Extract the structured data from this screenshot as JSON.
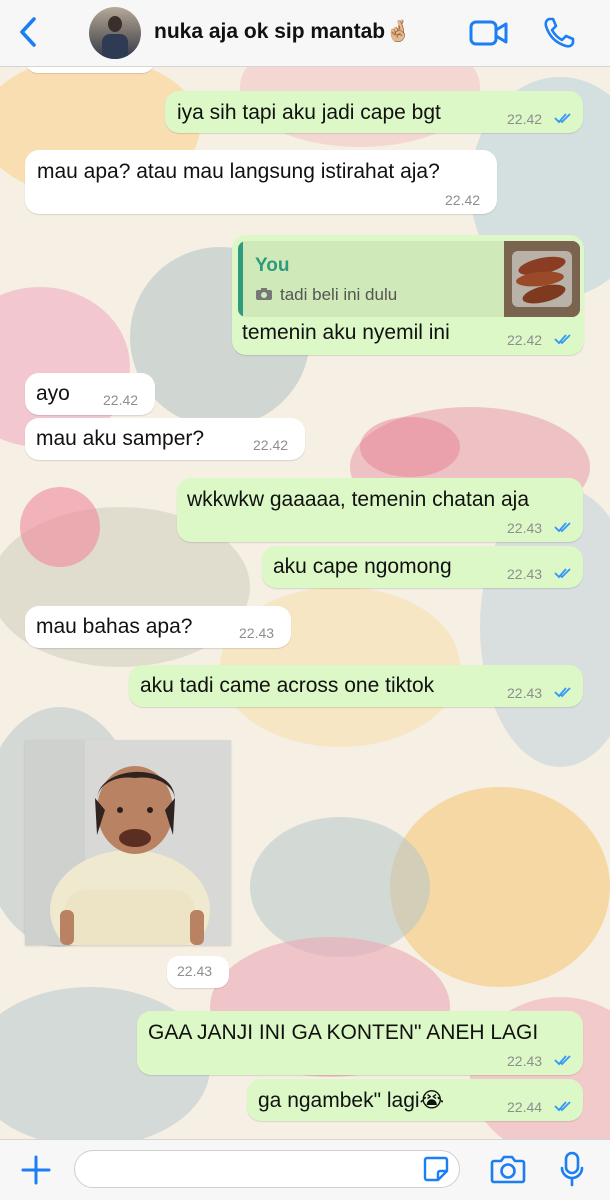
{
  "header": {
    "contact_name": "nuka aja ok sip mantab🤞🏼",
    "icons": {
      "back": "chevron-left-icon",
      "video": "video-call-icon",
      "call": "phone-icon"
    }
  },
  "colors": {
    "accent": "#1a7ef5",
    "outgoing_bubble": "#dcf8c6",
    "incoming_bubble": "#ffffff",
    "read_ticks": "#3497f9",
    "quote_accent": "#2e9b7f"
  },
  "messages": [
    {
      "dir": "out",
      "text": "iya sih tapi aku jadi cape bgt",
      "time": "22.42",
      "read": true
    },
    {
      "dir": "in",
      "text": "mau apa? atau mau langsung istirahat aja?",
      "time": "22.42"
    },
    {
      "dir": "out",
      "reply_to": {
        "author": "You",
        "snippet": "tadi beli ini dulu",
        "type": "photo"
      },
      "text": "temenin aku nyemil ini",
      "time": "22.42",
      "read": true
    },
    {
      "dir": "in",
      "text": "ayo",
      "time": "22.42"
    },
    {
      "dir": "in",
      "text": "mau aku samper?",
      "time": "22.42"
    },
    {
      "dir": "out",
      "text": "wkkwkw gaaaaa, temenin chatan aja",
      "time": "22.43",
      "read": true
    },
    {
      "dir": "out",
      "text": "aku cape ngomong",
      "time": "22.43",
      "read": true
    },
    {
      "dir": "in",
      "text": "mau bahas apa?",
      "time": "22.43"
    },
    {
      "dir": "out",
      "text": "aku tadi came across one tiktok",
      "time": "22.43",
      "read": true
    },
    {
      "dir": "in",
      "type": "sticker-photo",
      "time": "22.43"
    },
    {
      "dir": "out",
      "text": "GAA JANJI INI GA KONTEN\" ANEH LAGI",
      "time": "22.43",
      "read": true
    },
    {
      "dir": "out",
      "text": "ga ngambek\" lagi😭",
      "time": "22.44",
      "read": true
    }
  ],
  "input_bar": {
    "placeholder": "",
    "icons": {
      "add": "plus-icon",
      "sticker": "sticker-icon",
      "camera": "camera-icon",
      "mic": "microphone-icon"
    }
  }
}
